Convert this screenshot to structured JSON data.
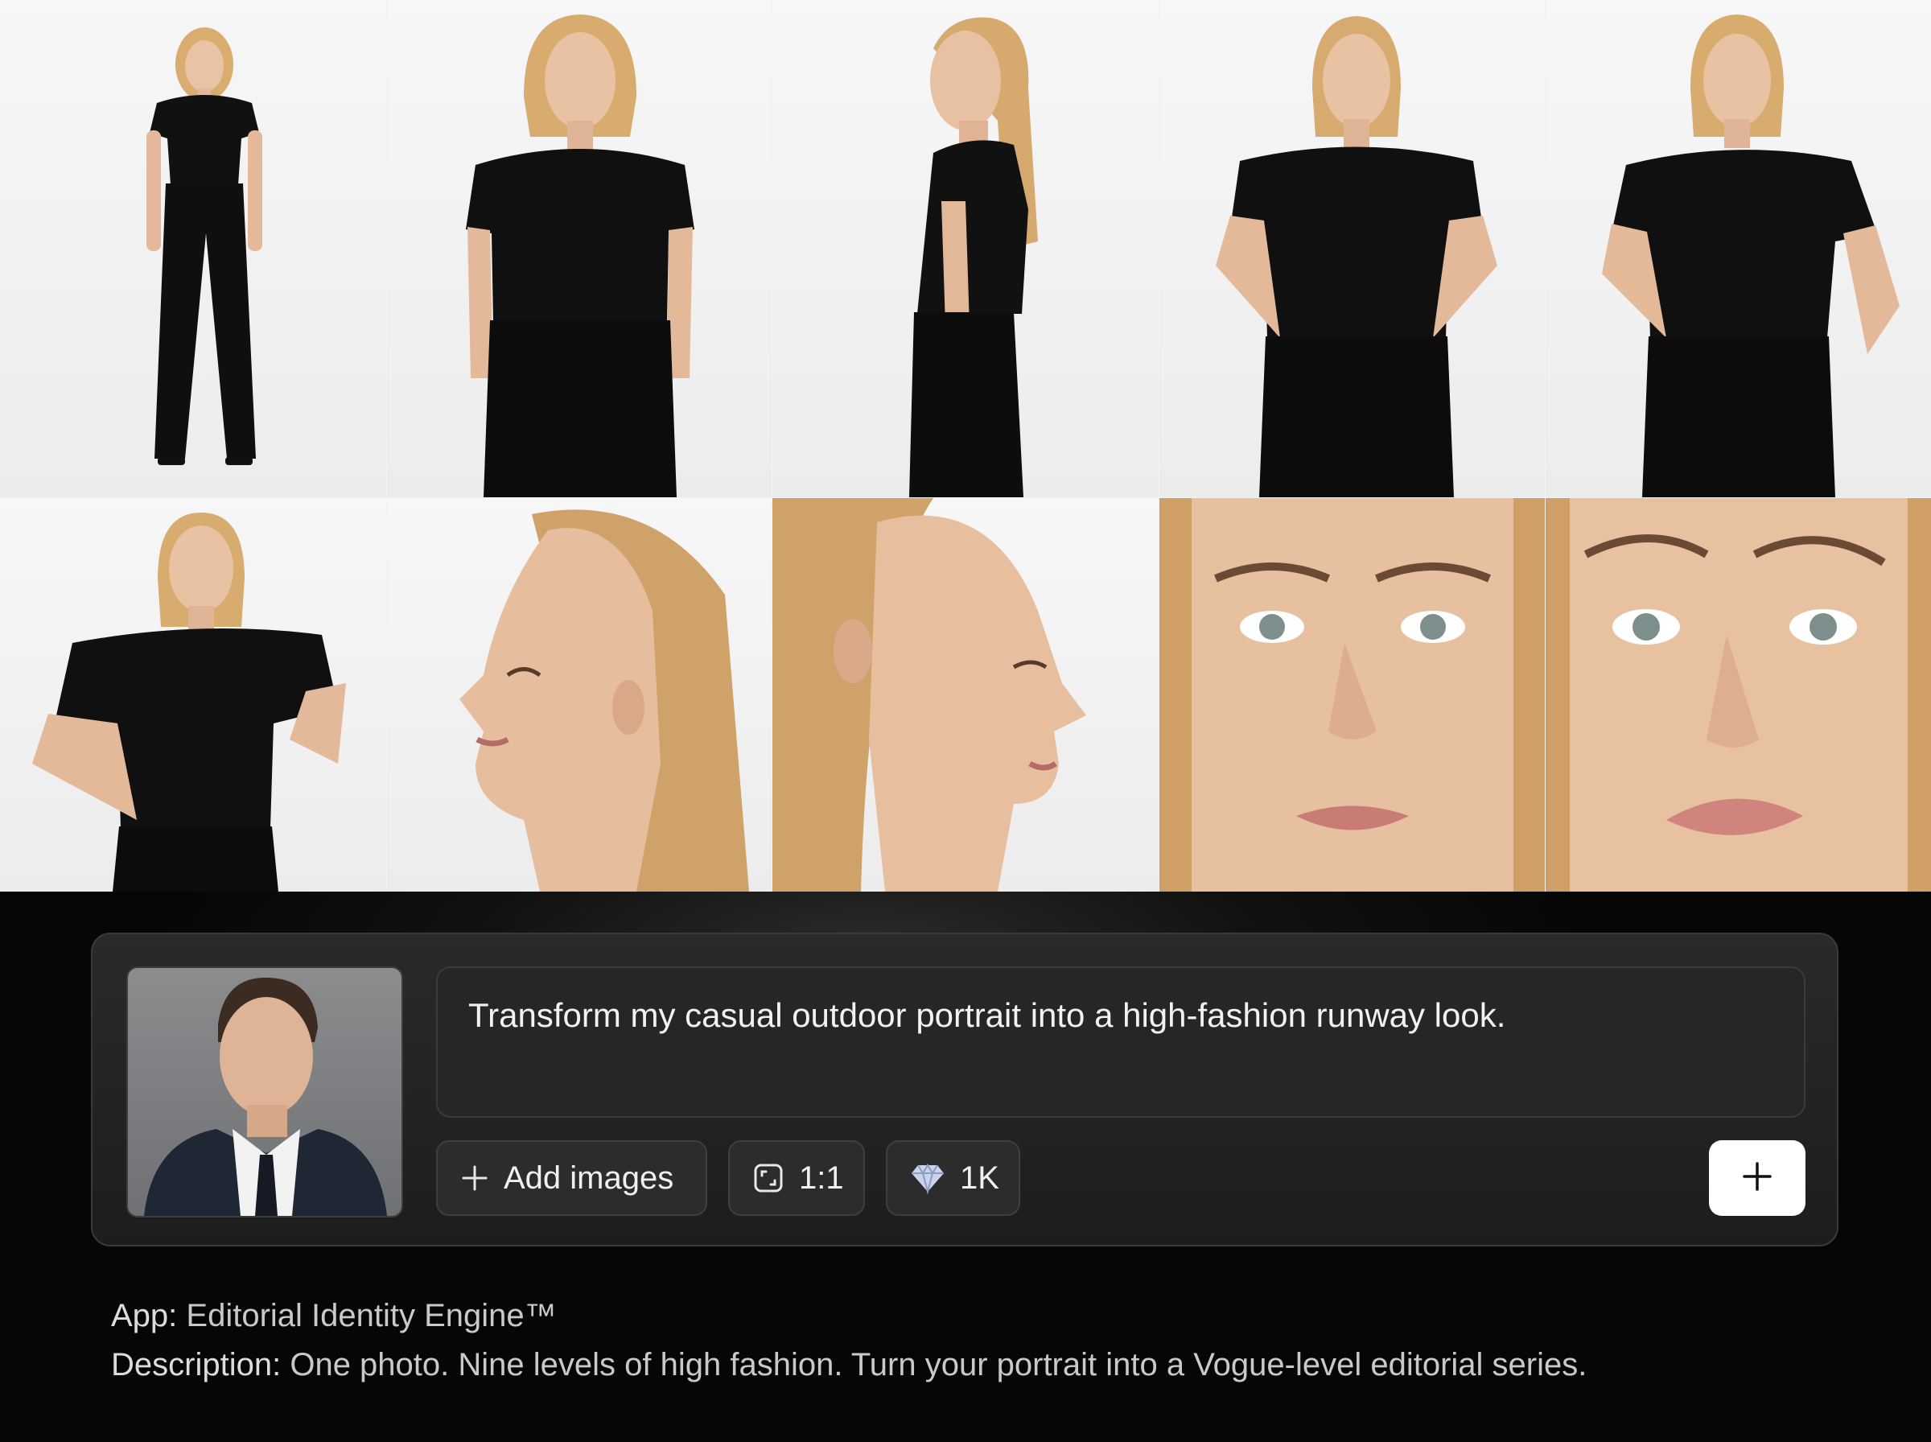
{
  "gallery": {
    "images": [
      {
        "name": "full-body-front",
        "kind": "full"
      },
      {
        "name": "three-quarter-hands-in-pockets",
        "kind": "full"
      },
      {
        "name": "profile-side-body",
        "kind": "full"
      },
      {
        "name": "hands-on-hips",
        "kind": "full"
      },
      {
        "name": "hand-on-hip-tugging-shirt",
        "kind": "full"
      },
      {
        "name": "three-quarter-tugging-shirt",
        "kind": "full"
      },
      {
        "name": "profile-face-left",
        "kind": "close"
      },
      {
        "name": "profile-face-right",
        "kind": "close"
      },
      {
        "name": "face-closeup-front",
        "kind": "close"
      },
      {
        "name": "face-closeup-tilted",
        "kind": "close"
      }
    ]
  },
  "composer": {
    "prompt_text": "Transform my casual outdoor portrait into a high-fashion runway look.",
    "add_images_label": "Add images",
    "aspect_ratio_label": "1:1",
    "resolution_label": "1K",
    "send_icon": "plus-icon"
  },
  "meta": {
    "app_label": "App:",
    "app_name": "Editorial Identity Engine™",
    "description_label": "Description:",
    "description_text": "One photo. Nine levels of high fashion. Turn your portrait into a Vogue-level editorial series."
  },
  "colors": {
    "background": "#070707",
    "panel": "#1f1f20",
    "border": "#3a3a3a",
    "text": "#f2f2f2",
    "send_button": "#ffffff"
  }
}
